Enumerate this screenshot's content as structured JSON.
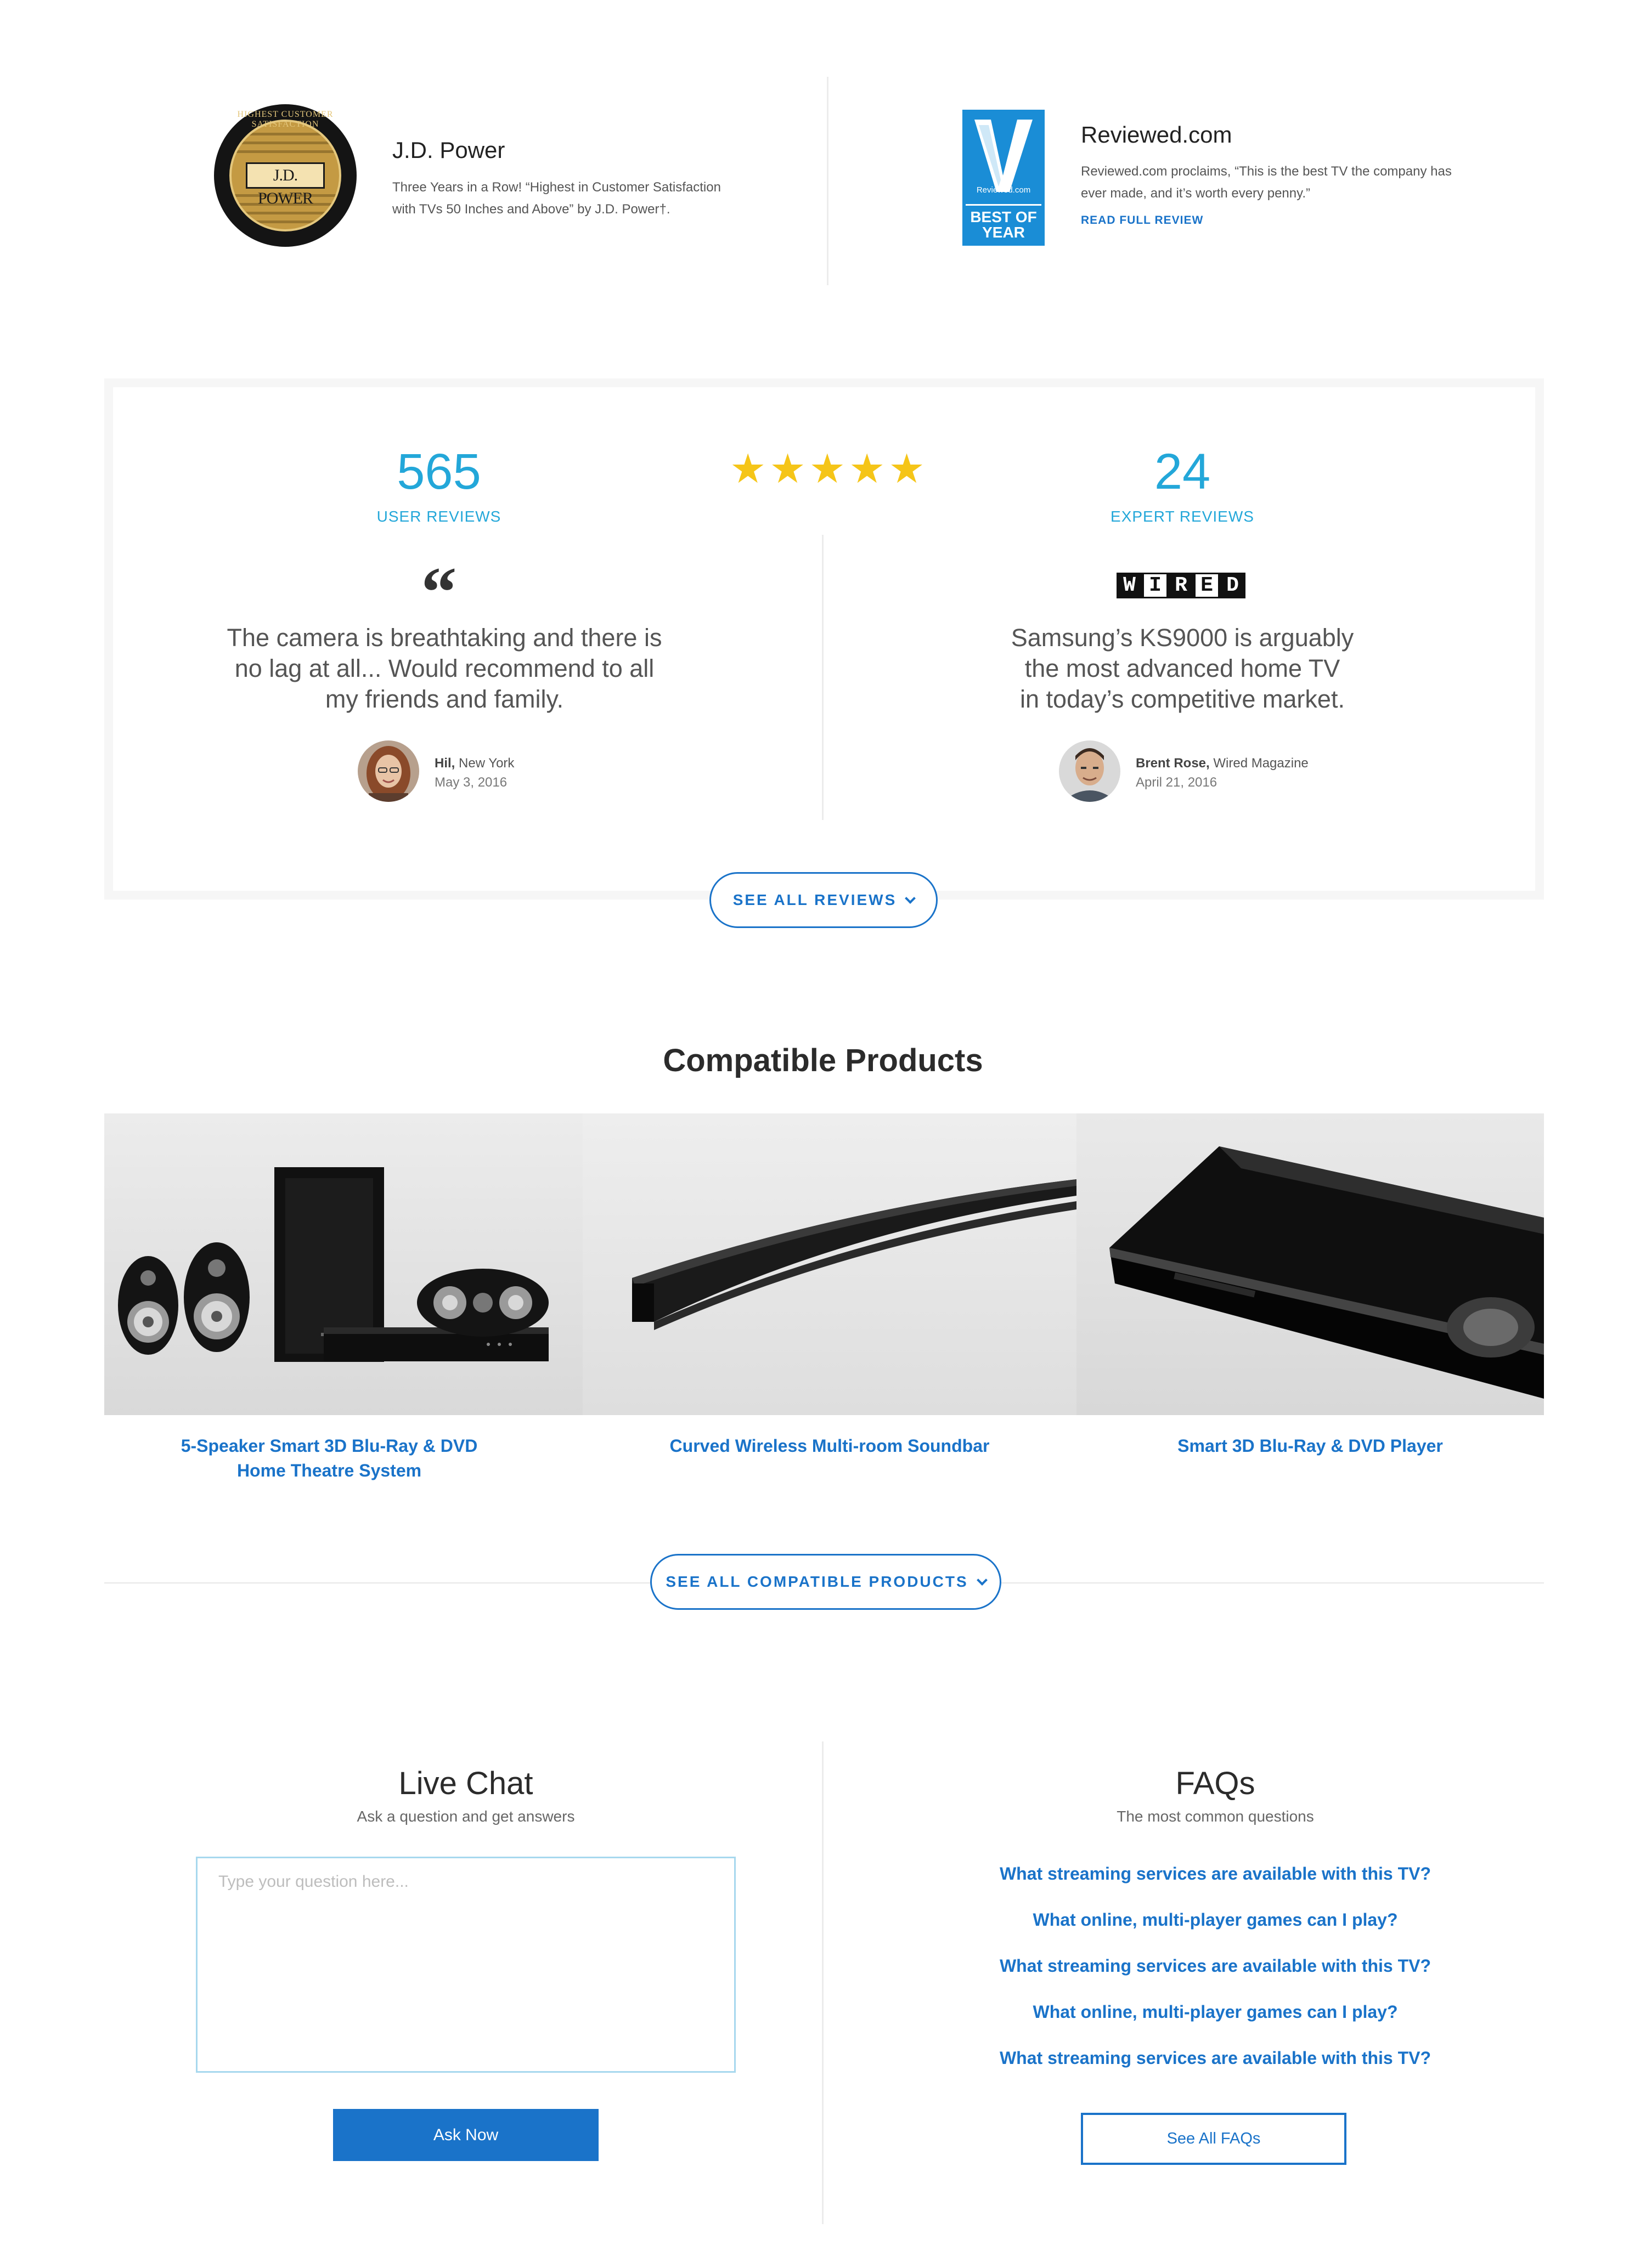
{
  "awards": [
    {
      "name": "J.D. Power",
      "text_lines": [
        "Three Years in a Row! “Highest in Customer Satisfaction",
        "with TVs 50 Inches and Above” by J.D. Power†."
      ],
      "logo_text": "J.D. POWER",
      "logo_arc_text": "HIGHEST CUSTOMER SATISFACTION"
    },
    {
      "name": "Reviewed.com",
      "text_lines": [
        "Reviewed.com proclaims, “This is the best TV the company has",
        "ever made, and it’s worth every penny.”"
      ],
      "link_label": "READ FULL REVIEW",
      "logo_brand": "Reviewed.com",
      "logo_badge": [
        "BEST OF",
        "YEAR"
      ]
    }
  ],
  "reviews": {
    "user": {
      "count": "565",
      "label": "USER REVIEWS",
      "quote_lines": [
        "The camera is breathtaking and there is",
        "no lag at all... Would recommend to all",
        "my friends and family."
      ],
      "reviewer_name": "Hil,",
      "reviewer_location": "New York",
      "date": "May 3, 2016"
    },
    "rating": {
      "stars": 5,
      "symbols": "★★★★★"
    },
    "expert": {
      "count": "24",
      "label": "EXPERT REVIEWS",
      "source_logo": [
        "W",
        "I",
        "R",
        "E",
        "D"
      ],
      "quote_lines": [
        "Samsung’s KS9000 is arguably",
        "the most advanced home TV",
        "in today’s competitive market."
      ],
      "reviewer_name": "Brent Rose,",
      "reviewer_location": "Wired Magazine",
      "date": "April 21, 2016"
    },
    "see_all_label": "SEE ALL REVIEWS"
  },
  "compatible": {
    "title": "Compatible Products",
    "products": [
      {
        "name_lines": [
          "5-Speaker Smart 3D Blu-Ray & DVD",
          "Home Theatre System"
        ]
      },
      {
        "name_lines": [
          "Curved Wireless Multi-room Soundbar"
        ]
      },
      {
        "name_lines": [
          "Smart 3D Blu-Ray & DVD Player"
        ]
      }
    ],
    "see_all_label": "SEE ALL COMPATIBLE PRODUCTS"
  },
  "live_chat": {
    "title": "Live Chat",
    "subtitle": "Ask a question and get answers",
    "placeholder": "Type your question here...",
    "button_label": "Ask Now"
  },
  "faqs": {
    "title": "FAQs",
    "subtitle": "The most common questions",
    "items": [
      "What streaming services are available with this TV?",
      "What online, multi-player games can I play?",
      "What streaming services are available with this TV?",
      "What online, multi-player games can I play?",
      "What streaming services are available with this TV?"
    ],
    "button_label": "See All FAQs"
  },
  "colors": {
    "accent_blue": "#1a73c9",
    "cyan": "#23a7d9",
    "star_yellow": "#f5c518",
    "reviewed_blue": "#1a8dd6",
    "jd_gold": "#c49a43"
  }
}
